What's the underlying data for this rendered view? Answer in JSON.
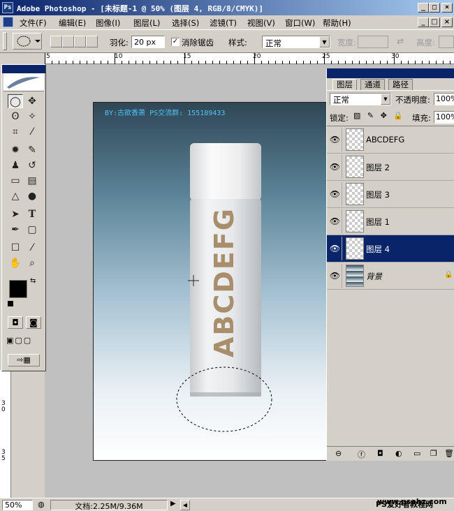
{
  "titlebar": {
    "title": "Adobe Photoshop - [未标题-1 @ 50% (图层 4, RGB/8/CMYK)]",
    "minimize": "_",
    "maximize": "□",
    "close": "×",
    "ps_icon": "Ps"
  },
  "menubar": {
    "items": [
      "文件(F)",
      "编辑(E)",
      "图像(I)",
      "图层(L)",
      "选择(S)",
      "滤镜(T)",
      "视图(V)",
      "窗口(W)",
      "帮助(H)"
    ]
  },
  "options": {
    "feather_label": "羽化:",
    "feather_value": "20 px",
    "antialias_label": "消除锯齿",
    "antialias_checked": "✓",
    "style_label": "样式:",
    "style_value": "正常",
    "width_label": "宽度:",
    "height_label": "高度:"
  },
  "ruler": {
    "h_ticks": [
      "5",
      "10",
      "15",
      "20",
      "25",
      "30"
    ],
    "v_ticks": [
      "3\n0",
      "3\n5"
    ]
  },
  "canvas": {
    "watermark": "BY:古欲香萧 PS交流群: 155189433",
    "bottle_text": "ABCDEFG"
  },
  "layers_panel": {
    "tabs": [
      "图层",
      "通道",
      "路径"
    ],
    "blend_mode": "正常",
    "opacity_label": "不透明度:",
    "opacity_value": "100%",
    "lock_label": "锁定:",
    "fill_label": "填充:",
    "fill_value": "100%",
    "layers": [
      {
        "name": "ABCDEFG",
        "selected": false,
        "eye": "👁"
      },
      {
        "name": "图层 2",
        "selected": false,
        "eye": "👁"
      },
      {
        "name": "图层 3",
        "selected": false,
        "eye": "👁"
      },
      {
        "name": "图层 1",
        "selected": false,
        "eye": "👁"
      },
      {
        "name": "图层 4",
        "selected": true,
        "eye": "👁"
      },
      {
        "name": "背景",
        "selected": false,
        "eye": "👁",
        "locked": "🔒"
      }
    ]
  },
  "statusbar": {
    "zoom": "50%",
    "doc_info": "文档:2.25M/9.36M",
    "site1": "PS爱好者教程网",
    "site2": "www.psahz.com"
  }
}
